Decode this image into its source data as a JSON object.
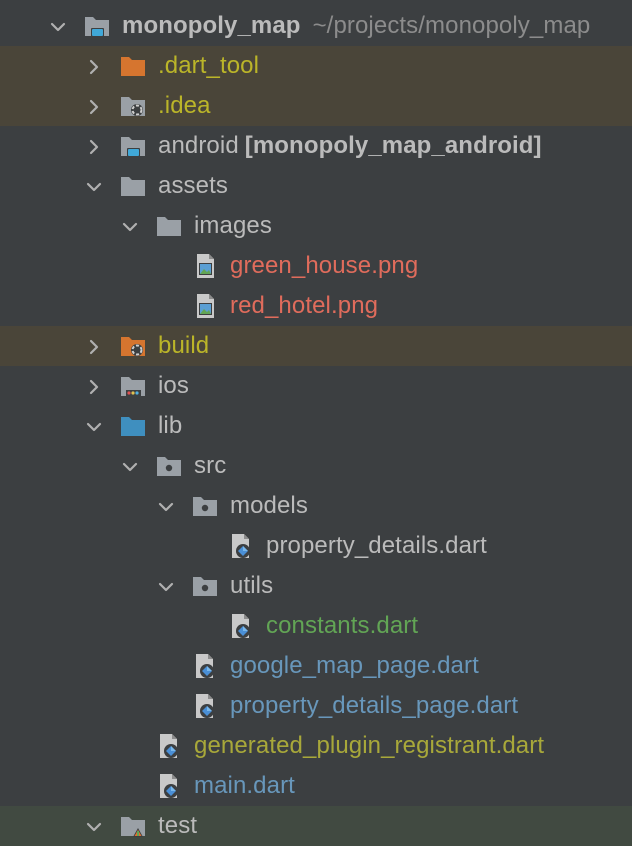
{
  "tree": [
    {
      "label": "monopoly_map",
      "extra": "~/projects/monopoly_map",
      "suffix": "",
      "depth": 0,
      "expanded": true,
      "icon": "module-folder-icon",
      "style": "bold",
      "color": "#bbbbbb",
      "row": ""
    },
    {
      "label": ".dart_tool",
      "extra": "",
      "suffix": "",
      "depth": 1,
      "expanded": false,
      "icon": "excluded-folder-icon",
      "style": "",
      "color": "#bbb529",
      "row": "excluded"
    },
    {
      "label": ".idea",
      "extra": "",
      "suffix": "",
      "depth": 1,
      "expanded": false,
      "icon": "idea-folder-icon",
      "style": "",
      "color": "#bbb529",
      "row": "excluded"
    },
    {
      "label": "android",
      "extra": "",
      "suffix": "[monopoly_map_android]",
      "depth": 1,
      "expanded": false,
      "icon": "module-folder-icon",
      "style": "",
      "color": "#bbbbbb",
      "row": ""
    },
    {
      "label": "assets",
      "extra": "",
      "suffix": "",
      "depth": 1,
      "expanded": true,
      "icon": "folder-icon",
      "style": "",
      "color": "#bbbbbb",
      "row": ""
    },
    {
      "label": "images",
      "extra": "",
      "suffix": "",
      "depth": 2,
      "expanded": true,
      "icon": "folder-icon",
      "style": "",
      "color": "#bbbbbb",
      "row": ""
    },
    {
      "label": "green_house.png",
      "extra": "",
      "suffix": "",
      "depth": 3,
      "expanded": null,
      "icon": "image-file-icon",
      "style": "",
      "color": "#e06c5c",
      "row": ""
    },
    {
      "label": "red_hotel.png",
      "extra": "",
      "suffix": "",
      "depth": 3,
      "expanded": null,
      "icon": "image-file-icon",
      "style": "",
      "color": "#e06c5c",
      "row": ""
    },
    {
      "label": "build",
      "extra": "",
      "suffix": "",
      "depth": 1,
      "expanded": false,
      "icon": "build-folder-icon",
      "style": "",
      "color": "#bbb529",
      "row": "excluded"
    },
    {
      "label": "ios",
      "extra": "",
      "suffix": "",
      "depth": 1,
      "expanded": false,
      "icon": "ios-folder-icon",
      "style": "",
      "color": "#bbbbbb",
      "row": ""
    },
    {
      "label": "lib",
      "extra": "",
      "suffix": "",
      "depth": 1,
      "expanded": true,
      "icon": "source-folder-icon",
      "style": "",
      "color": "#bbbbbb",
      "row": ""
    },
    {
      "label": "src",
      "extra": "",
      "suffix": "",
      "depth": 2,
      "expanded": true,
      "icon": "package-folder-icon",
      "style": "",
      "color": "#bbbbbb",
      "row": ""
    },
    {
      "label": "models",
      "extra": "",
      "suffix": "",
      "depth": 3,
      "expanded": true,
      "icon": "package-folder-icon",
      "style": "",
      "color": "#bbbbbb",
      "row": ""
    },
    {
      "label": "property_details.dart",
      "extra": "",
      "suffix": "",
      "depth": 4,
      "expanded": null,
      "icon": "dart-file-icon",
      "style": "",
      "color": "#bbbbbb",
      "row": ""
    },
    {
      "label": "utils",
      "extra": "",
      "suffix": "",
      "depth": 3,
      "expanded": true,
      "icon": "package-folder-icon",
      "style": "",
      "color": "#bbbbbb",
      "row": ""
    },
    {
      "label": "constants.dart",
      "extra": "",
      "suffix": "",
      "depth": 4,
      "expanded": null,
      "icon": "dart-file-icon",
      "style": "",
      "color": "#62a555",
      "row": ""
    },
    {
      "label": "google_map_page.dart",
      "extra": "",
      "suffix": "",
      "depth": 3,
      "expanded": null,
      "icon": "dart-file-icon",
      "style": "",
      "color": "#6897bb",
      "row": ""
    },
    {
      "label": "property_details_page.dart",
      "extra": "",
      "suffix": "",
      "depth": 3,
      "expanded": null,
      "icon": "dart-file-icon",
      "style": "",
      "color": "#6897bb",
      "row": ""
    },
    {
      "label": "generated_plugin_registrant.dart",
      "extra": "",
      "suffix": "",
      "depth": 2,
      "expanded": null,
      "icon": "dart-file-icon",
      "style": "",
      "color": "#a8a83a",
      "row": ""
    },
    {
      "label": "main.dart",
      "extra": "",
      "suffix": "",
      "depth": 2,
      "expanded": null,
      "icon": "dart-file-icon",
      "style": "",
      "color": "#6897bb",
      "row": ""
    },
    {
      "label": "test",
      "extra": "",
      "suffix": "",
      "depth": 1,
      "expanded": true,
      "icon": "test-folder-icon",
      "style": "",
      "color": "#bbbbbb",
      "row": "test"
    }
  ],
  "colors": {
    "background": "#3c3f41",
    "excluded_row": "#4a4539",
    "test_row": "#414a41",
    "folder": "#9aa0a6",
    "excluded_folder": "#d6752f",
    "source_folder": "#3f8fbf",
    "dart_blue": "#4a8fd6"
  }
}
